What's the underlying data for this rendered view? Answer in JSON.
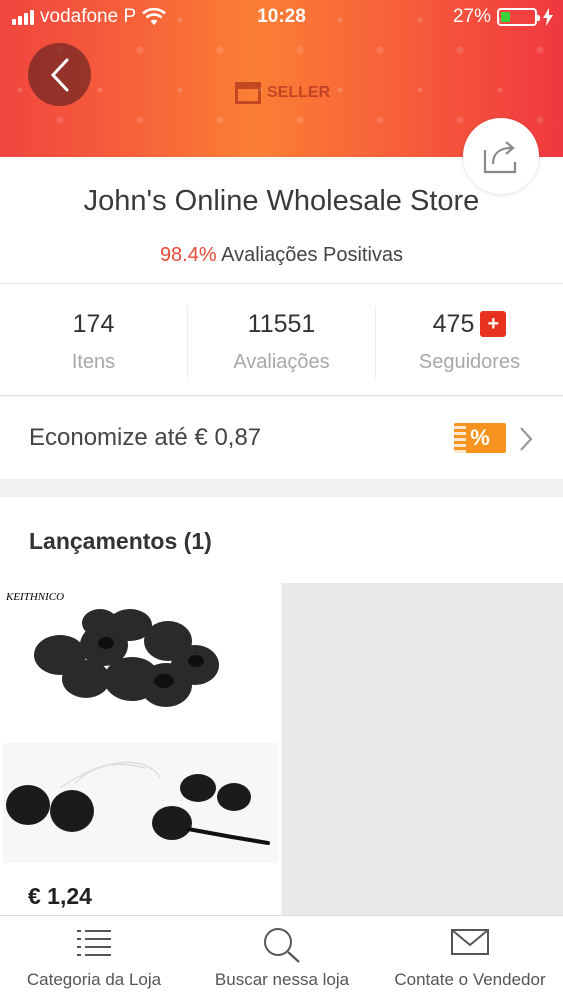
{
  "status_bar": {
    "carrier": "vodafone P",
    "time": "10:28",
    "battery": "27%",
    "battery_level": 0.27
  },
  "header": {
    "seller_badge": "SELLER"
  },
  "store": {
    "name": "John's Online Wholesale Store",
    "rating_percent": "98.4%",
    "rating_label": "Avaliações Positivas"
  },
  "stats": [
    {
      "value": "174",
      "label": "Itens"
    },
    {
      "value": "11551",
      "label": "Avaliações"
    },
    {
      "value": "475",
      "label": "Seguidores",
      "badge": "+"
    }
  ],
  "savings": {
    "text": "Economize até € 0,87",
    "badge": "%"
  },
  "new_arrivals": {
    "title": "Lançamentos (1)",
    "products": [
      {
        "brand": "KEITHNICO",
        "price": "€ 1,24"
      }
    ]
  },
  "bottom_nav": [
    {
      "label": "Categoria da Loja",
      "icon": "list-icon"
    },
    {
      "label": "Buscar nessa loja",
      "icon": "search-icon"
    },
    {
      "label": "Contate o Vendedor",
      "icon": "mail-icon"
    }
  ],
  "colors": {
    "accent_red": "#e84a3a",
    "badge_red": "#e8321f",
    "badge_orange": "#f7931e",
    "header_gradient_center": "#fb7f34"
  }
}
